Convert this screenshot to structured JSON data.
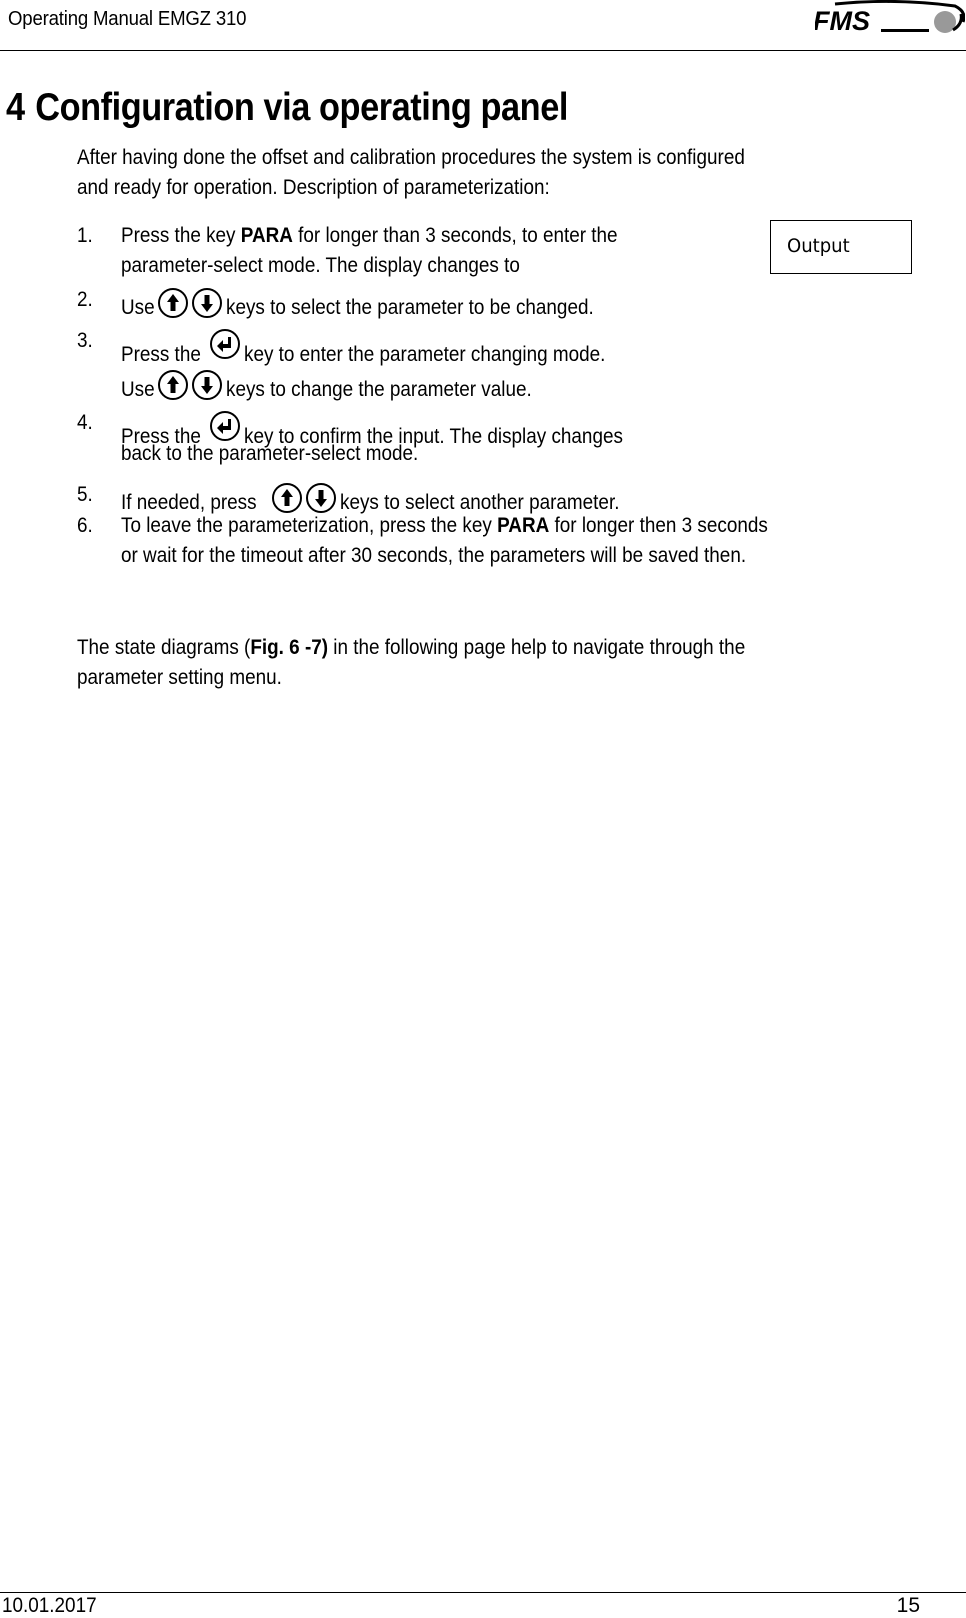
{
  "header": {
    "title": "Operating Manual EMGZ 310",
    "logo_text": "FMS"
  },
  "section": {
    "number": "4",
    "title": "Configuration via operating panel"
  },
  "intro": {
    "line1": "After having done the offset and calibration procedures the system is configured",
    "line2": "and ready for operation. Description of parameterization:"
  },
  "display_box": {
    "label": "Output"
  },
  "steps": [
    {
      "number": "1.",
      "lines": [
        {
          "pre": "Press the key ",
          "bold": "PARA",
          "post": " for longer than 3 seconds, to enter the"
        },
        {
          "pre": "parameter-select mode. The display changes to"
        }
      ]
    },
    {
      "number": "2.",
      "lines": [
        {
          "pre": "Use ",
          "keys": [
            "up-arrow-key",
            "down-arrow-key"
          ],
          "post": " keys to select the parameter to be changed."
        }
      ]
    },
    {
      "number": "3.",
      "lines": [
        {
          "pre": "Press the ",
          "keys": [
            "enter-key"
          ],
          "post": " key to enter the parameter changing mode."
        },
        {
          "pre": "Use ",
          "keys": [
            "up-arrow-key",
            "down-arrow-key"
          ],
          "post": " keys to change the parameter value."
        }
      ]
    },
    {
      "number": "4.",
      "lines": [
        {
          "pre": "Press the ",
          "keys": [
            "enter-key"
          ],
          "post": " key to confirm the input. The display changes"
        },
        {
          "pre": "back to the parameter-select mode."
        }
      ]
    },
    {
      "number": "5.",
      "lines": [
        {
          "pre": "If needed, press ",
          "keys": [
            "up-arrow-key",
            "down-arrow-key"
          ],
          "post": " keys to select another parameter."
        }
      ]
    },
    {
      "number": "6.",
      "lines": [
        {
          "pre": "To leave the parameterization, press the key ",
          "bold": "PARA",
          "post": " for longer then 3 seconds"
        },
        {
          "pre": "or wait for the timeout after 30 seconds, the parameters will be saved then."
        }
      ]
    }
  ],
  "closing": {
    "pre": "The state diagrams (",
    "ref": "Fig. 6 -7)",
    "post1": " in the following page help to navigate through the",
    "line2": "parameter setting menu."
  },
  "footer": {
    "date": "10.01.2017",
    "page": "15"
  }
}
